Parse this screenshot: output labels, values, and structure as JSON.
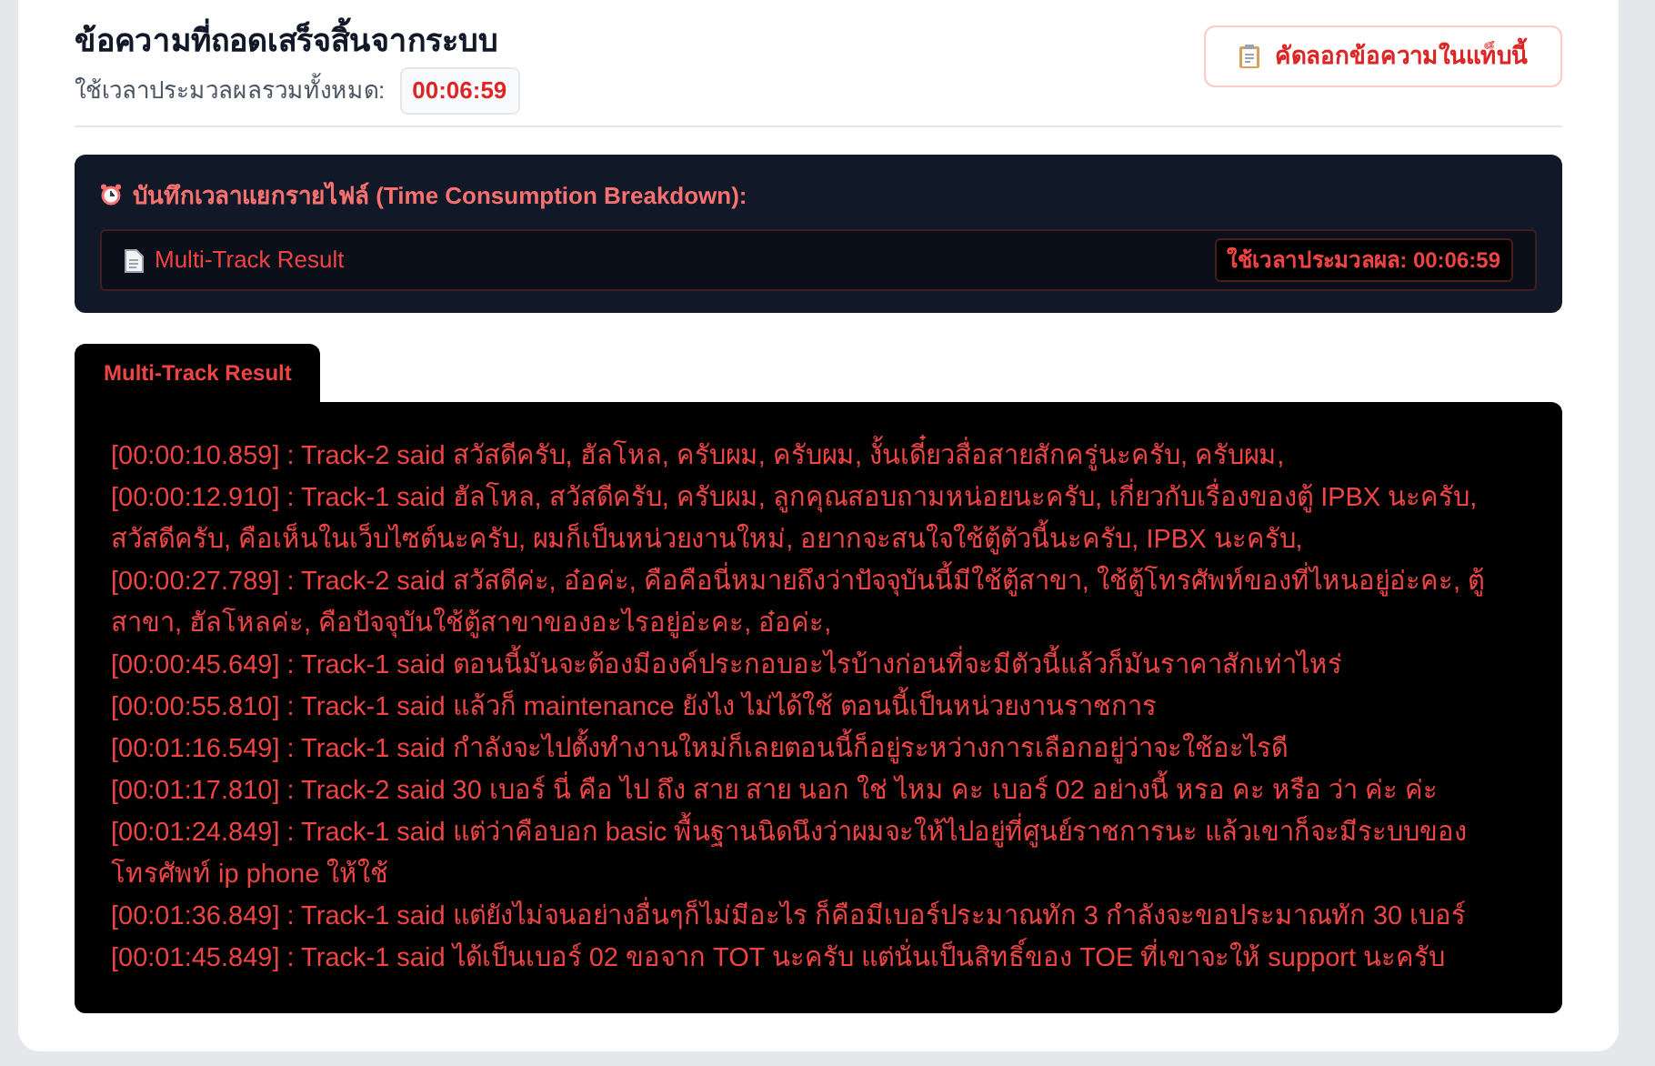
{
  "header": {
    "title": "ข้อความที่ถอดเสร็จสิ้นจากระบบ",
    "total_label": "ใช้เวลาประมวลผลรวมทั้งหมด:",
    "total_time": "00:06:59",
    "copy_button": "คัดลอกข้อความในแท็บนี้"
  },
  "breakdown": {
    "title": "บันทึกเวลาแยกรายไฟล์ (Time Consumption Breakdown):",
    "files": [
      {
        "name": "Multi-Track Result",
        "time": "ใช้เวลาประมวลผล: 00:06:59"
      }
    ]
  },
  "tabs": [
    {
      "label": "Multi-Track Result",
      "selected": true
    }
  ],
  "transcript": [
    "[00:00:10.859] : Track-2 said สวัสดีครับ, ฮัลโหล, ครับผม, ครับผม, งั้นเดี๋ยวสื่อสายสักครู่นะครับ, ครับผม,",
    "[00:00:12.910] : Track-1 said ฮัลโหล, สวัสดีครับ, ครับผม, ลูกคุณสอบถามหน่อยนะครับ, เกี่ยวกับเรื่องของตู้ IPBX นะครับ, สวัสดีครับ, คือเห็นในเว็บไซต์นะครับ, ผมก็เป็นหน่วยงานใหม่, อยากจะสนใจใช้ตู้ตัวนี้นะครับ, IPBX นะครับ,",
    "[00:00:27.789] : Track-2 said สวัสดีค่ะ, อ๋อค่ะ, คือคือนี่หมายถึงว่าปัจจุบันนี้มีใช้ตู้สาขา, ใช้ตู้โทรศัพท์ของที่ไหนอยู่อ่ะคะ, ตู้สาขา, ฮัลโหลค่ะ, คือปัจจุบันใช้ตู้สาขาของอะไรอยู่อ่ะคะ, อ๋อค่ะ,",
    "[00:00:45.649] : Track-1 said ตอนนี้มันจะต้องมีองค์ประกอบอะไรบ้างก่อนที่จะมีตัวนี้แล้วก็มันราคาสักเท่าไหร่",
    "[00:00:55.810] : Track-1 said แล้วก็ maintenance ยังไง ไม่ได้ใช้ ตอนนี้เป็นหน่วยงานราชการ",
    "[00:01:16.549] : Track-1 said กำลังจะไปตั้งทำงานใหม่ก็เลยตอนนี้ก็อยู่ระหว่างการเลือกอยู่ว่าจะใช้อะไรดี",
    "[00:01:17.810] : Track-2 said 30 เบอร์ นี่ คือ ไป ถึง สาย สาย นอก ใช่ ไหม คะ เบอร์ 02 อย่างนี้ หรอ คะ หรือ ว่า ค่ะ ค่ะ",
    "[00:01:24.849] : Track-1 said แต่ว่าคือบอก basic พื้นฐานนิดนึงว่าผมจะให้ไปอยู่ที่ศูนย์ราชการนะ แล้วเขาก็จะมีระบบของโทรศัพท์ ip phone ให้ใช้",
    "[00:01:36.849] : Track-1 said แต่ยังไม่จนอย่างอื่นๆก็ไม่มีอะไร ก็คือมีเบอร์ประมาณทัก 3 กำลังจะขอประมาณทัก 30 เบอร์",
    "[00:01:45.849] : Track-1 said ได้เป็นเบอร์ 02 ขอจาก TOT นะครับ แต่นั่นเป็นสิทธิ์ของ TOE ที่เขาจะให้ support นะครับ"
  ]
}
